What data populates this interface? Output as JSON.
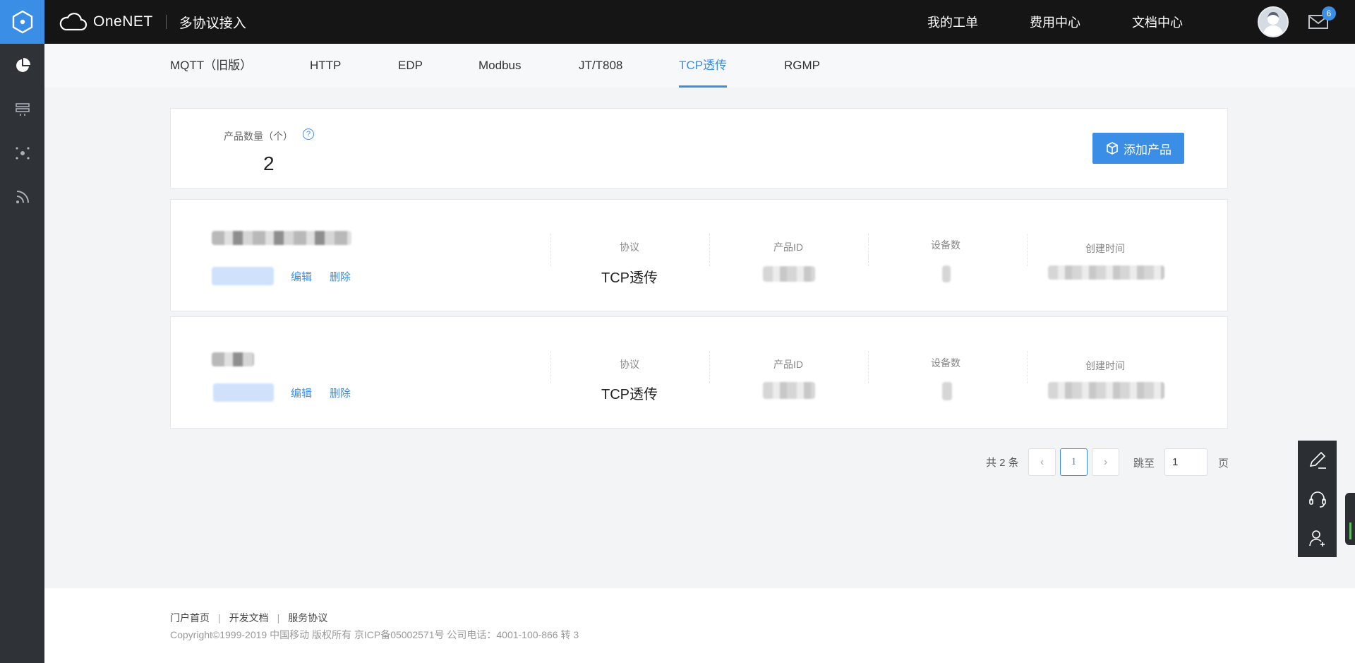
{
  "header": {
    "brand_name": "OneNET",
    "brand_sub": "多协议接入",
    "nav": [
      "我的工单",
      "费用中心",
      "文档中心"
    ],
    "mail_badge": "6"
  },
  "sidebar": {
    "icons": [
      "dashboard-pie-icon",
      "device-list-icon",
      "network-nodes-icon",
      "feed-signal-icon"
    ]
  },
  "tabs": [
    "MQTT（旧版）",
    "HTTP",
    "EDP",
    "Modbus",
    "JT/T808",
    "TCP透传",
    "RGMP"
  ],
  "active_tab": "TCP透传",
  "summary": {
    "label": "产品数量（个）",
    "help": "?",
    "count": "2",
    "add_button": "添加产品"
  },
  "products": [
    {
      "edit": "编辑",
      "delete": "删除",
      "protocol_label": "协议",
      "protocol": "TCP透传",
      "id_label": "产品ID",
      "devices_label": "设备数",
      "created_label": "创建时间"
    },
    {
      "edit": "编辑",
      "delete": "删除",
      "protocol_label": "协议",
      "protocol": "TCP透传",
      "id_label": "产品ID",
      "devices_label": "设备数",
      "created_label": "创建时间"
    }
  ],
  "pagination": {
    "total": "共 2 条",
    "prev": "‹",
    "current": "1",
    "next": "›",
    "jump_label": "跳至",
    "jump_value": "1",
    "page_label": "页"
  },
  "float_tools": [
    "edit-pen-icon",
    "headset-icon",
    "add-user-icon"
  ],
  "footer": {
    "links": [
      "门户首页",
      "开发文档",
      "服务协议"
    ],
    "copyright": "Copyright©1999-2019 中国移动 版权所有 京ICP备05002571号 公司电话：4001-100-866 转 3"
  },
  "colors": {
    "accent": "#3b8ee6",
    "topbar": "#151515",
    "sidebar": "#2f3237"
  }
}
